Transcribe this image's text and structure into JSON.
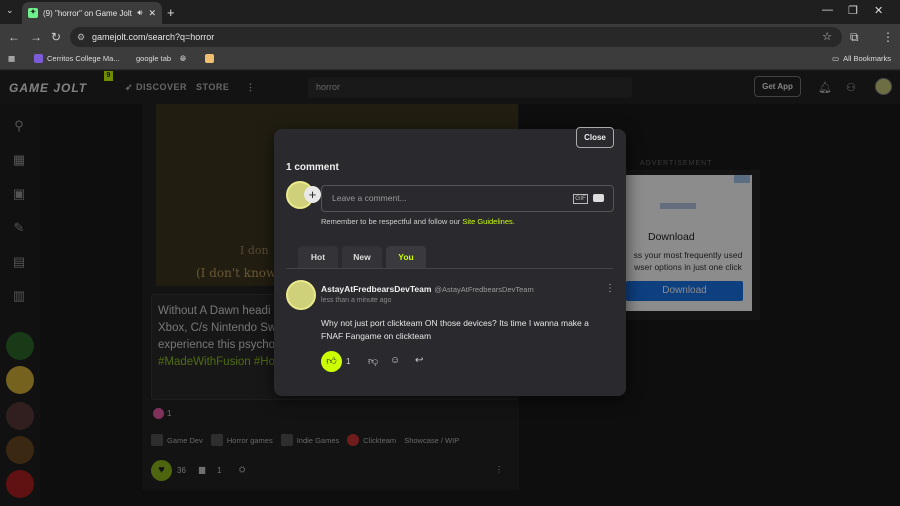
{
  "browser": {
    "tab_title": "(9) \"horror\" on Game Jolt",
    "url": "gamejolt.com/search?q=horror",
    "bookmarks": [
      "Cerritos College Ma...",
      "google tab"
    ],
    "all_bookmarks": "All Bookmarks"
  },
  "gamejolt": {
    "logo": "GAME JOLT",
    "logo_badge": "9",
    "nav_discover": "DISCOVER",
    "nav_store": "STORE",
    "search_value": "horror",
    "get_app": "Get App"
  },
  "post": {
    "image_text_1": "I don",
    "image_text_2": "(I don't know",
    "text_lines": [
      "Without A Dawn headi",
      "Xbox, C/s Nintendo Swi",
      "experience this psychol"
    ],
    "hashtags": "#MadeWithFusion #Ho",
    "like_count_small": "1",
    "tags": [
      "Game Dev",
      "Horror games",
      "Indie Games",
      "Clickteam",
      "Showcase / WIP"
    ],
    "likes": "36",
    "comments": "1"
  },
  "ad": {
    "label": "ADVERTISEMENT",
    "heading": "Download",
    "body": "ss your most frequently used wser options in just one click",
    "button": "Download"
  },
  "modal": {
    "close": "Close",
    "title": "1 comment",
    "input_placeholder": "Leave a comment...",
    "gif_label": "GIF",
    "guidelines_prefix": "Remember to be respectful and follow our ",
    "guidelines_link": "Site Guidelines",
    "guidelines_suffix": ".",
    "tabs": [
      "Hot",
      "New",
      "You"
    ],
    "comment": {
      "author": "AstayAtFredbearsDevTeam",
      "handle": "@AstayAtFredbearsDevTeam",
      "time": "less than a minute ago",
      "body": "Why not just port clickteam ON those devices? Its time I wanna make a FNAF Fangame on clickteam",
      "likes": "1"
    }
  },
  "colors": {
    "accent": "#ccff00",
    "like_green": "#8ab81a",
    "hashtag": "#8fc31f"
  }
}
